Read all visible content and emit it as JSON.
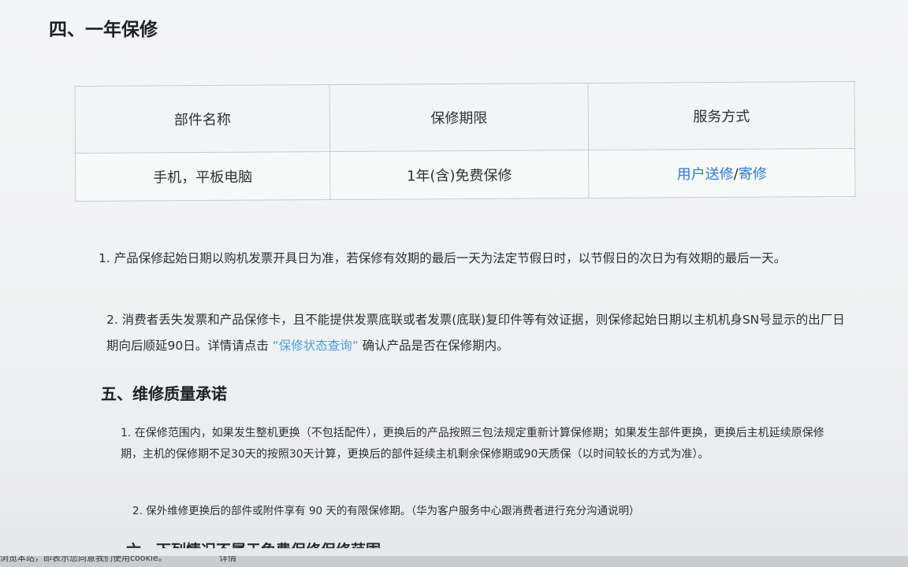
{
  "section4": {
    "title": "四、一年保修"
  },
  "warranty_table": {
    "headers": [
      "部件名称",
      "保修期限",
      "服务方式"
    ],
    "row": {
      "part": "手机，平板电脑",
      "period": "1年(含)免费保修",
      "service_link_1": "用户送修",
      "separator": "/",
      "service_link_2": "寄修"
    }
  },
  "notes": {
    "n1": "1. 产品保修起始日期以购机发票开具日为准，若保修有效期的最后一天为法定节假日时，以节假日的次日为有效期的最后一天。",
    "n2_before": "2. 消费者丢失发票和产品保修卡，且不能提供发票底联或者发票(底联)复印件等有效证据，则保修起始日期以主机机身SN号显示的出厂日期向后顺延90日。详情请点击",
    "n2_link": "“保修状态查询”",
    "n2_after": "确认产品是否在保修期内。"
  },
  "section5": {
    "title": "五、维修质量承诺",
    "q1": "1. 在保修范围内，如果发生整机更换（不包括配件），更换后的产品按照三包法规定重新计算保修期；如果发生部件更换，更换后主机延续原保修期，主机的保修期不足30天的按照30天计算，更换后的部件延续主机剩余保修期或90天质保（以时间较长的方式为准）。",
    "q2": "2. 保外维修更换后的部件或附件享有 90 天的有限保修期。（华为客户服务中心跟消费者进行充分沟通说明）"
  },
  "partial_heading": "六、下列情况不属于免费保修保修范围",
  "cookie_bar": {
    "text": "浏览本站，即表示您同意我们使用cookie。",
    "link": "详情"
  }
}
